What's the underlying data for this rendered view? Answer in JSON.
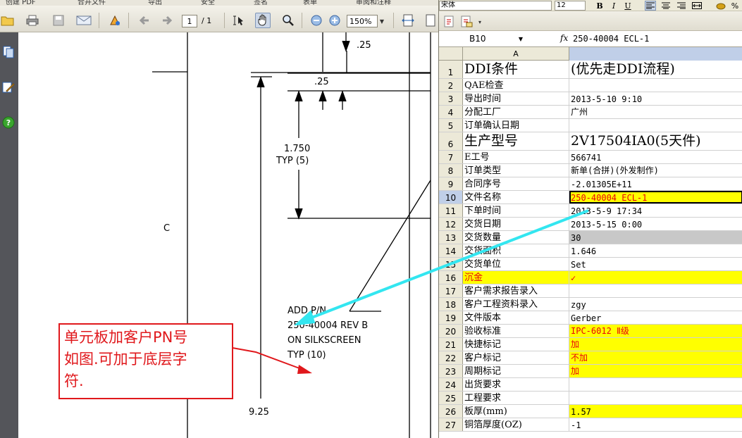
{
  "pdf": {
    "menu": [
      "创建 PDF",
      "合并文件",
      "导出",
      "安全",
      "签名",
      "表单",
      "审阅和注释"
    ],
    "toolbar": {
      "page_current": "1",
      "page_total": "/ 1",
      "zoom": "150%"
    },
    "drawing": {
      "dim_25_top": ".25",
      "dim_25_mid": ".25",
      "dim_1750": "1.750",
      "dim_typ5": "TYP (5)",
      "label_c": "C",
      "note_line1": "ADD P/N",
      "note_line2": "250-40004 REV B",
      "note_line3": "ON SILKSCREEN",
      "note_line4": "TYP (10)",
      "dim_925": "9.25"
    },
    "callout": {
      "lines": [
        "单元板加客户PN号",
        "如图.可加于底层字",
        "符."
      ]
    }
  },
  "sheet": {
    "font_name": "宋体",
    "font_size": "12",
    "name_box": "B10",
    "fx": "fx",
    "formula": "250-40004 ECL-1",
    "col_a": "A",
    "rows": [
      {
        "n": "1",
        "a": "DDI条件",
        "b": "(优先走DDI流程)",
        "big": true
      },
      {
        "n": "2",
        "a": "QAE检查",
        "b": ""
      },
      {
        "n": "3",
        "a": "导出时间",
        "b": "2013-5-10 9:10"
      },
      {
        "n": "4",
        "a": "分配工厂",
        "b": "广州"
      },
      {
        "n": "5",
        "a": "订单确认日期",
        "b": ""
      },
      {
        "n": "6",
        "a": "生产型号",
        "b": "2V17504IA0(5天件)",
        "big": true
      },
      {
        "n": "7",
        "a": "E工号",
        "b": "566741"
      },
      {
        "n": "8",
        "a": "订单类型",
        "b": "新单(合拼)(外发制作)"
      },
      {
        "n": "9",
        "a": "合同序号",
        "b": "-2.01305E+11"
      },
      {
        "n": "10",
        "a": "文件名称",
        "b": "250-40004 ECL-1",
        "bclass": "yel red selcell",
        "sel": true
      },
      {
        "n": "11",
        "a": "下单时间",
        "b": "2013-5-9 17:34"
      },
      {
        "n": "12",
        "a": "交货日期",
        "b": "2013-5-15 0:00"
      },
      {
        "n": "13",
        "a": "交货数量",
        "b": "30",
        "bclass": "gry"
      },
      {
        "n": "14",
        "a": "交货面积",
        "b": "1.646"
      },
      {
        "n": "15",
        "a": "交货单位",
        "b": "Set"
      },
      {
        "n": "16",
        "a": "沉金",
        "b": "✓",
        "aclass": "yel red",
        "bclass": "yel red"
      },
      {
        "n": "17",
        "a": "客户需求报告录入",
        "b": ""
      },
      {
        "n": "18",
        "a": "客户工程资料录入",
        "b": "zgy"
      },
      {
        "n": "19",
        "a": "文件版本",
        "b": "Gerber"
      },
      {
        "n": "20",
        "a": "验收标准",
        "b": "IPC-6012 Ⅱ级",
        "bclass": "yel red"
      },
      {
        "n": "21",
        "a": "快捷标记",
        "b": "加",
        "bclass": "yel red"
      },
      {
        "n": "22",
        "a": "客户标记",
        "b": "不加",
        "bclass": "yel red"
      },
      {
        "n": "23",
        "a": "周期标记",
        "b": "加",
        "bclass": "yel red"
      },
      {
        "n": "24",
        "a": "出货要求",
        "b": ""
      },
      {
        "n": "25",
        "a": "工程要求",
        "b": ""
      },
      {
        "n": "26",
        "a": "板厚(mm)",
        "b": "1.57",
        "bclass": "yel"
      },
      {
        "n": "27",
        "a": "铜箔厚度(OZ)",
        "b": "-1"
      }
    ]
  },
  "colors": {
    "callout_red": "#e0181c",
    "arrow_cyan": "#33e6f0",
    "highlight_yellow": "#ffff00",
    "selected_header": "#c0cfe8"
  }
}
